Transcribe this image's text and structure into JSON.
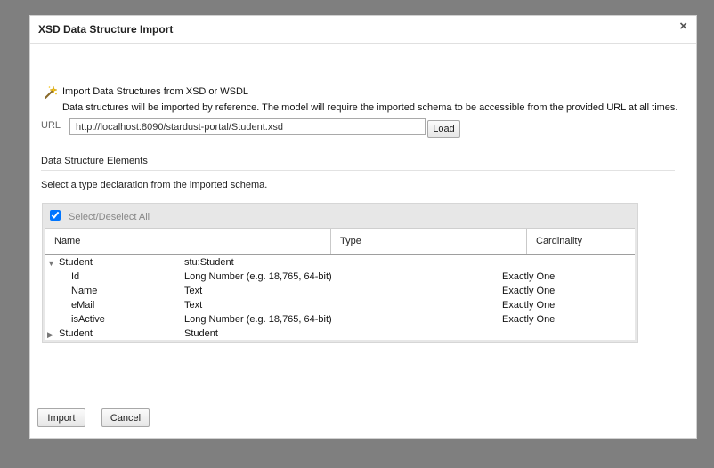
{
  "dialog": {
    "title": "XSD Data Structure Import",
    "close_label": "×"
  },
  "import": {
    "heading": "Import Data Structures from XSD or WSDL",
    "description": "Data structures will be imported by reference. The model will require the imported schema to be accessible from the provided URL at all times.",
    "url_label": "URL",
    "url_value": "http://localhost:8090/stardust-portal/Student.xsd",
    "load_label": "Load",
    "icon": "magic-wand-icon"
  },
  "elements": {
    "section_title": "Data Structure Elements",
    "instruction": "Select a type declaration from the imported schema.",
    "select_all_label": "Select/Deselect All",
    "select_all_checked": true,
    "columns": {
      "name": "Name",
      "type": "Type",
      "cardinality": "Cardinality"
    },
    "rows": [
      {
        "name": "Student",
        "type": "stu:Student",
        "cardinality": "",
        "toggle": "▼"
      },
      {
        "name": "Id",
        "type": "Long Number (e.g. 18,765, 64-bit)",
        "cardinality": "Exactly One",
        "toggle": ""
      },
      {
        "name": "Name",
        "type": "Text",
        "cardinality": "Exactly One",
        "toggle": ""
      },
      {
        "name": "eMail",
        "type": "Text",
        "cardinality": "Exactly One",
        "toggle": ""
      },
      {
        "name": "isActive",
        "type": "Long Number (e.g. 18,765, 64-bit)",
        "cardinality": "Exactly One",
        "toggle": ""
      },
      {
        "name": "Student",
        "type": "Student",
        "cardinality": "",
        "toggle": "▶"
      }
    ]
  },
  "footer": {
    "import_label": "Import",
    "cancel_label": "Cancel"
  }
}
